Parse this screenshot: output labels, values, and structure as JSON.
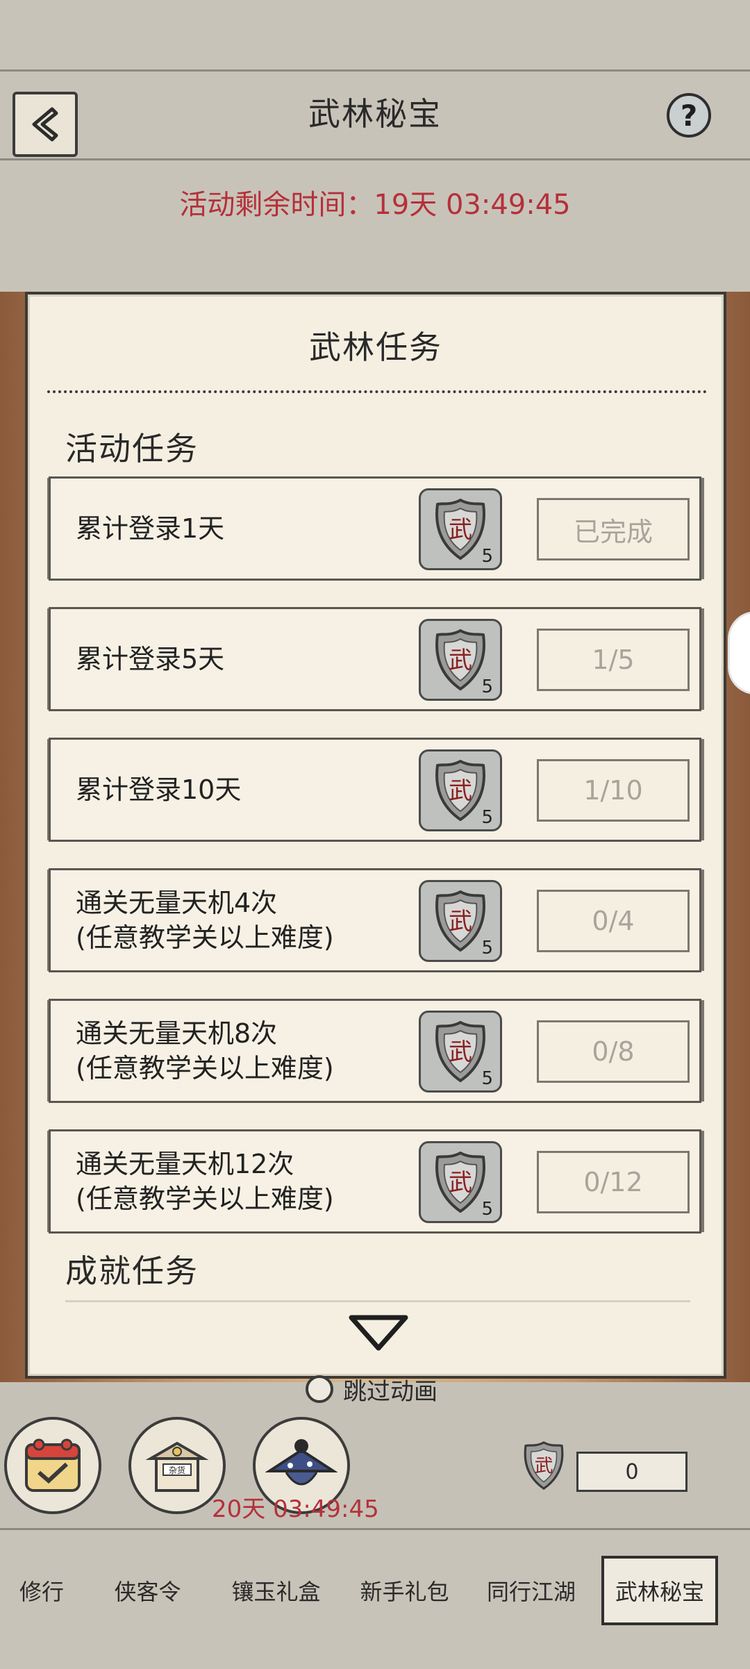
{
  "header": {
    "title": "武林秘宝",
    "help_label": "?",
    "timer_text": "活动剩余时间：19天 03:49:45"
  },
  "modal": {
    "title": "武林任务",
    "section_activity": "活动任务",
    "section_achievement": "成就任务",
    "tasks": [
      {
        "name_line1": "累计登录1天",
        "name_line2": "",
        "reward_icon": "wu-token-icon",
        "reward_count": "5",
        "progress": "已完成"
      },
      {
        "name_line1": "累计登录5天",
        "name_line2": "",
        "reward_icon": "wu-token-icon",
        "reward_count": "5",
        "progress": "1/5"
      },
      {
        "name_line1": "累计登录10天",
        "name_line2": "",
        "reward_icon": "wu-token-icon",
        "reward_count": "5",
        "progress": "1/10"
      },
      {
        "name_line1": "通关无量天机4次",
        "name_line2": "(任意教学关以上难度)",
        "reward_icon": "wu-token-icon",
        "reward_count": "5",
        "progress": "0/4"
      },
      {
        "name_line1": "通关无量天机8次",
        "name_line2": "(任意教学关以上难度)",
        "reward_icon": "wu-token-icon",
        "reward_count": "5",
        "progress": "0/8"
      },
      {
        "name_line1": "通关无量天机12次",
        "name_line2": "(任意教学关以上难度)",
        "reward_icon": "wu-token-icon",
        "reward_count": "5",
        "progress": "0/12"
      }
    ],
    "token_glyph": "武"
  },
  "skip": {
    "label": "跳过动画"
  },
  "bottom": {
    "event_timer": "20天 03:49:45",
    "token_count": "0",
    "icons": [
      "calendar-check-icon",
      "shop-icon",
      "hat-character-icon"
    ],
    "shop_sign": "杂货"
  },
  "tabs": [
    {
      "label": "修行",
      "active": false
    },
    {
      "label": "侠客令",
      "active": false
    },
    {
      "label": "镶玉礼盒",
      "active": false
    },
    {
      "label": "新手礼包",
      "active": false
    },
    {
      "label": "同行江湖",
      "active": false
    },
    {
      "label": "武林秘宝",
      "active": true
    }
  ],
  "colors": {
    "accent_red": "#b5303a",
    "paper": "#f4efe1",
    "ink": "#2a2a2a"
  }
}
